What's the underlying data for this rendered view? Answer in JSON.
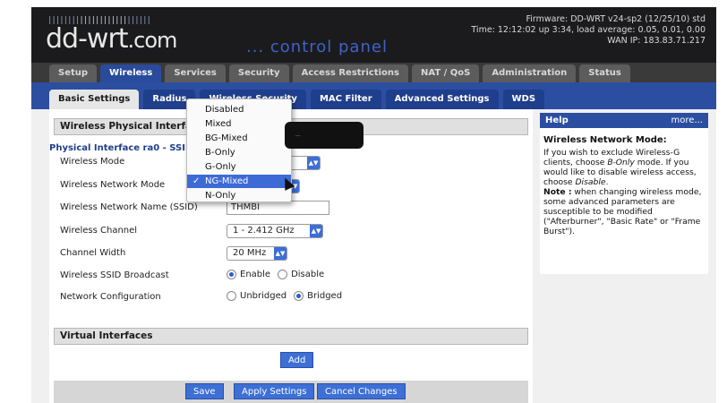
{
  "header": {
    "logo_bar_dim": "||||||||",
    "logo_bar_hi": "||||||||||||",
    "logo_bar_end": "||||||",
    "logo_main": "dd-wrt",
    "logo_suffix": ".com",
    "control_panel": "... control panel",
    "firmware": "Firmware: DD-WRT v24-sp2 (12/25/10) std",
    "time": "Time: 12:12:02 up 3:34, load average: 0.05, 0.01, 0.00",
    "wan_ip": "WAN IP: 183.83.71.217"
  },
  "main_tabs": [
    {
      "label": "Setup",
      "active": false
    },
    {
      "label": "Wireless",
      "active": true
    },
    {
      "label": "Services",
      "active": false
    },
    {
      "label": "Security",
      "active": false
    },
    {
      "label": "Access Restrictions",
      "active": false
    },
    {
      "label": "NAT / QoS",
      "active": false
    },
    {
      "label": "Administration",
      "active": false
    },
    {
      "label": "Status",
      "active": false
    }
  ],
  "sub_tabs": [
    {
      "label": "Basic Settings",
      "active": true
    },
    {
      "label": "Radius",
      "active": false
    },
    {
      "label": "Wireless Security",
      "active": false
    },
    {
      "label": "MAC Filter",
      "active": false
    },
    {
      "label": "Advanced Settings",
      "active": false
    },
    {
      "label": "WDS",
      "active": false
    }
  ],
  "physical_section": {
    "heading": "Wireless Physical Interface w",
    "iface_title": "Physical Interface ra0 - SSID [THMBI",
    "labels": {
      "mode": "Wireless Mode",
      "network_mode": "Wireless Network Mode",
      "ssid": "Wireless Network Name (SSID)",
      "channel": "Wireless Channel",
      "width": "Channel Width",
      "broadcast": "Wireless SSID Broadcast",
      "netconfig": "Network Configuration"
    },
    "ssid_value": "THMBI",
    "channel_value": "1 - 2.412 GHz",
    "width_value": "20 MHz",
    "broadcast_enable": "Enable",
    "broadcast_disable": "Disable",
    "netconfig_unbridged": "Unbridged",
    "netconfig_bridged": "Bridged"
  },
  "network_mode_dropdown": {
    "options": [
      "Disabled",
      "Mixed",
      "BG-Mixed",
      "B-Only",
      "G-Only",
      "NG-Mixed",
      "N-Only"
    ],
    "selected": "NG-Mixed",
    "check": "✓"
  },
  "tooltip_text": "...",
  "virtual_section": {
    "heading": "Virtual Interfaces",
    "add_label": "Add"
  },
  "buttons": {
    "save": "Save",
    "apply": "Apply Settings",
    "cancel": "Cancel Changes"
  },
  "help": {
    "title": "Help",
    "more": "more...",
    "heading": "Wireless Network Mode:",
    "p1_a": "If you wish to exclude Wireless-G clients, choose ",
    "p1_b": "B-Only",
    "p1_c": " mode. If you would like to disable wireless access, choose ",
    "p1_d": "Disable",
    "p1_e": ".",
    "note_label": "Note :",
    "note_text": " when changing wireless mode, some advanced parameters are susceptible to be modified (\"Afterburner\", \"Basic Rate\" or \"Frame Burst\")."
  },
  "colors": {
    "header_bg": "#1b1b1d",
    "tab_active": "#2a4b9b",
    "subtab_bar": "#2c4ea1",
    "button_blue": "#3d6fd6"
  }
}
